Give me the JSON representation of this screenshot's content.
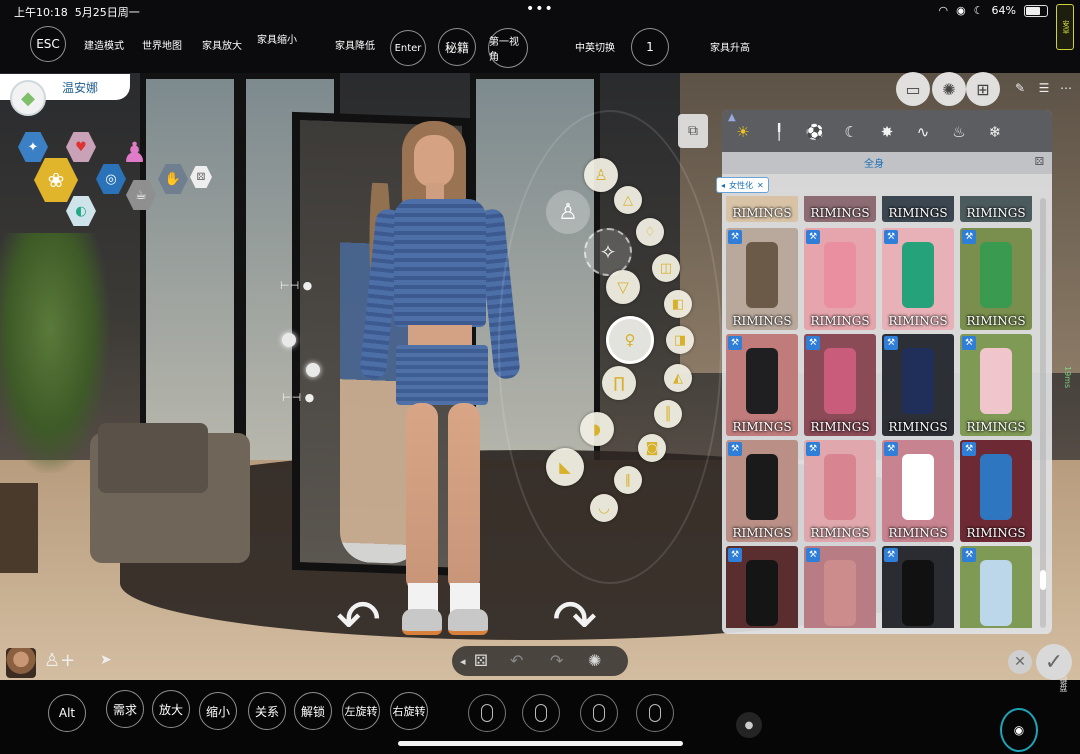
{
  "status_bar": {
    "time": "上午10:18",
    "date": "5月25日周一",
    "dots": "•••",
    "battery": "64%",
    "app_badge": "安卓"
  },
  "top_keys": [
    "ESC",
    "建造模式",
    "世界地图",
    "家具放大",
    "家具缩小",
    "家具降低",
    "Enter",
    "秘籍",
    "第一视角",
    "中英切换",
    "1",
    "家具升高"
  ],
  "household": {
    "sim_name": "温安娜"
  },
  "catalog": {
    "category_label": "全身",
    "filter_chip": "女性化",
    "filter_close": "✕",
    "brand_label": "RIMINGS",
    "tabs": [
      {
        "icon": "sun-icon",
        "glyph": "☀",
        "active": true
      },
      {
        "icon": "tie-icon",
        "glyph": "╿",
        "active": false
      },
      {
        "icon": "ball-icon",
        "glyph": "⚽",
        "active": false
      },
      {
        "icon": "moon-icon",
        "glyph": "☾",
        "active": false
      },
      {
        "icon": "party-icon",
        "glyph": "✸",
        "active": false
      },
      {
        "icon": "swim-icon",
        "glyph": "∿",
        "active": false
      },
      {
        "icon": "flame-icon",
        "glyph": "♨",
        "active": false
      },
      {
        "icon": "cold-icon",
        "glyph": "❄",
        "active": false
      }
    ],
    "items": [
      {
        "bg": "#b9a99c",
        "garment": "#6b5a48"
      },
      {
        "bg": "#e6a5ad",
        "garment": "#e98fa0"
      },
      {
        "bg": "#e8b1b7",
        "garment": "#25a279"
      },
      {
        "bg": "#7a8f4d",
        "garment": "#3a9a4f"
      },
      {
        "bg": "#c07b7b",
        "garment": "#1f1f22"
      },
      {
        "bg": "#8a4a56",
        "garment": "#c85c7a"
      },
      {
        "bg": "#2d2f36",
        "garment": "#1f2f5a"
      },
      {
        "bg": "#7f9a55",
        "garment": "#f0c6cc"
      },
      {
        "bg": "#b98f86",
        "garment": "#1a1a1a"
      },
      {
        "bg": "#e0a8ad",
        "garment": "#d88591"
      },
      {
        "bg": "#c7838f",
        "garment": "#ffffff"
      },
      {
        "bg": "#6d2a35",
        "garment": "#2f76c1"
      },
      {
        "bg": "#5a2e2e",
        "garment": "#151515"
      },
      {
        "bg": "#b87c85",
        "garment": "#cc8c8c"
      },
      {
        "bg": "#2a2c32",
        "garment": "#111111"
      },
      {
        "bg": "#7f9a55",
        "garment": "#bcd6ea"
      }
    ]
  },
  "bottom_keys": [
    "Alt",
    "需求",
    "放大",
    "缩小",
    "关系",
    "解锁",
    "左旋转",
    "右旋转"
  ],
  "side": {
    "ping": "19ms",
    "keyboard": "键盘"
  },
  "colors": {
    "accent_gold": "#f0c21f",
    "link_blue": "#1b6fb8",
    "panel_bg": "#e1e2e4"
  }
}
